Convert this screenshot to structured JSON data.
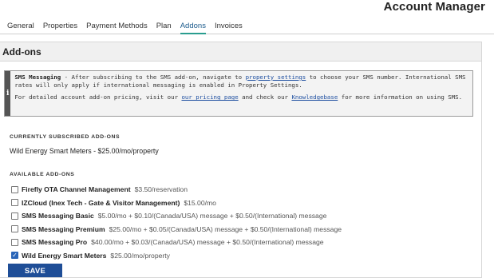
{
  "header": {
    "title": "Account Manager"
  },
  "tabs": [
    {
      "label": "General"
    },
    {
      "label": "Properties"
    },
    {
      "label": "Payment Methods"
    },
    {
      "label": "Plan"
    },
    {
      "label": "Addons",
      "active": true
    },
    {
      "label": "Invoices"
    }
  ],
  "panel": {
    "title": "Add-ons"
  },
  "info": {
    "icon": "info-icon",
    "icon_glyph": "i",
    "sms_title": "SMS Messaging",
    "sms_text_1": " - After subscribing to the SMS add-on, navigate to ",
    "sms_link": "property settings",
    "sms_text_2": " to choose your SMS number. International SMS rates will only apply if international messaging is enabled in Property Settings.",
    "pricing_text_1": "For detailed account add-on pricing, visit our ",
    "pricing_link": "our pricing page",
    "pricing_text_2": " and check our ",
    "kb_link": "Knowledgebase",
    "pricing_text_3": " for more information on using SMS."
  },
  "current": {
    "label": "CURRENTLY SUBSCRIBED ADD-ONS",
    "value": "Wild Energy Smart Meters - $25.00/mo/property"
  },
  "available": {
    "label": "AVAILABLE ADD-ONS",
    "items": [
      {
        "name": "Firefly OTA Channel Management",
        "price": "$3.50/reservation",
        "checked": false
      },
      {
        "name": "IZCloud (Inex Tech - Gate & Visitor Management)",
        "price": "$15.00/mo",
        "checked": false
      },
      {
        "name": "SMS Messaging Basic",
        "price": "$5.00/mo + $0.10/(Canada/USA) message + $0.50/(International) message",
        "checked": false
      },
      {
        "name": "SMS Messaging Premium",
        "price": "$25.00/mo + $0.05/(Canada/USA) message + $0.50/(International) message",
        "checked": false
      },
      {
        "name": "SMS Messaging Pro",
        "price": "$40.00/mo + $0.03/(Canada/USA) message + $0.50/(International) message",
        "checked": false
      },
      {
        "name": "Wild Energy Smart Meters",
        "price": "$25.00/mo/property",
        "checked": true
      }
    ]
  },
  "save_label": "SAVE",
  "colors": {
    "accent": "#1f4e97",
    "active_tab_underline": "#2a9d8f",
    "link": "#1d4ea0"
  }
}
